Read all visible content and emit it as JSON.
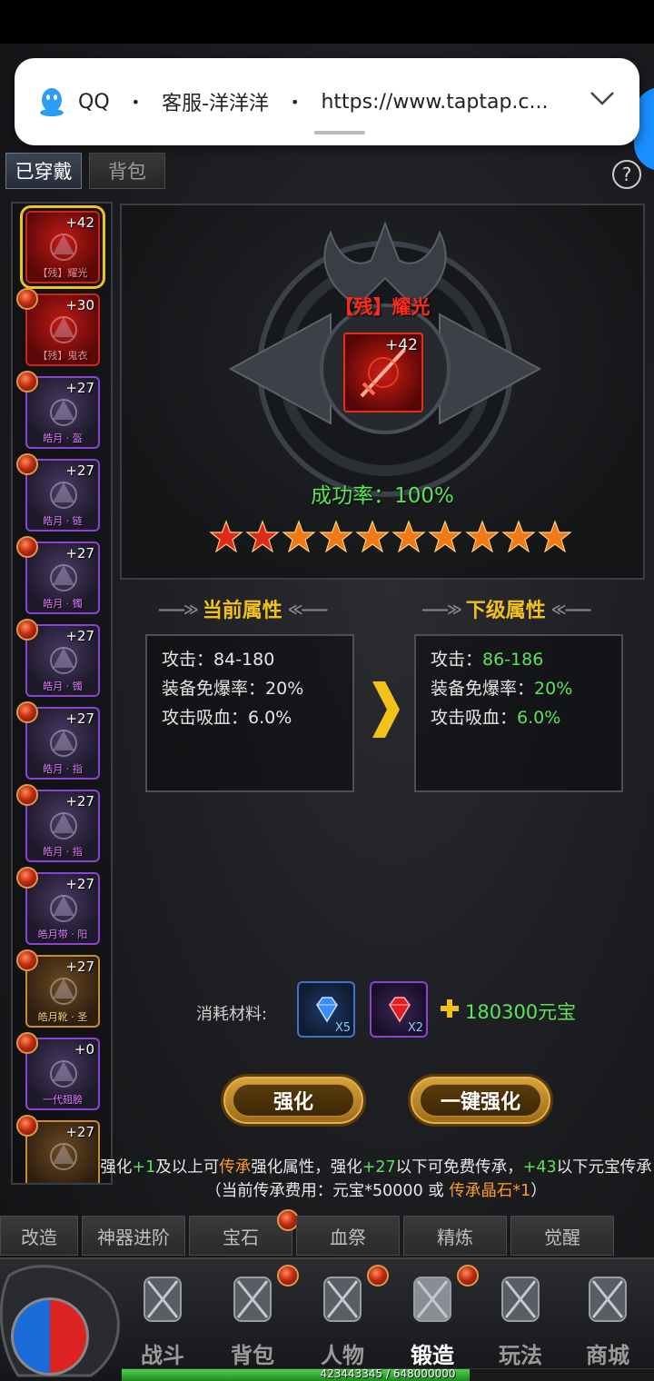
{
  "notification": {
    "app": "QQ",
    "contact": "客服-洋洋洋",
    "url": "https://www.taptap.c..."
  },
  "tabs": {
    "worn": "已穿戴",
    "bag": "背包"
  },
  "help": "?",
  "equipment": [
    {
      "level": "+42",
      "name": "【残】耀光",
      "rarity": "red"
    },
    {
      "level": "+30",
      "name": "【残】鬼衣",
      "rarity": "red"
    },
    {
      "level": "+27",
      "name": "皓月 · 盔",
      "rarity": "purple"
    },
    {
      "level": "+27",
      "name": "皓月 · 链",
      "rarity": "purple"
    },
    {
      "level": "+27",
      "name": "皓月 · 镯",
      "rarity": "purple"
    },
    {
      "level": "+27",
      "name": "皓月 · 镯",
      "rarity": "purple"
    },
    {
      "level": "+27",
      "name": "皓月 · 指",
      "rarity": "purple"
    },
    {
      "level": "+27",
      "name": "皓月 · 指",
      "rarity": "purple"
    },
    {
      "level": "+27",
      "name": "皓月带 · 阳",
      "rarity": "purple"
    },
    {
      "level": "+27",
      "name": "皓月靴 · 圣",
      "rarity": "gold"
    },
    {
      "level": "+0",
      "name": "一代翅膀",
      "rarity": "purple"
    },
    {
      "level": "+27",
      "name": "",
      "rarity": "gold"
    }
  ],
  "preview": {
    "item_name": "【残】耀光",
    "item_level": "+42",
    "success_label": "成功率：",
    "success_value": "100%",
    "stars": 10
  },
  "current": {
    "header": "当前属性",
    "rows": [
      {
        "label": "攻击：",
        "value": "84-180"
      },
      {
        "label": "装备免爆率：",
        "value": "20%"
      },
      {
        "label": "攻击吸血：",
        "value": "6.0%"
      }
    ]
  },
  "next": {
    "header": "下级属性",
    "rows": [
      {
        "label": "攻击：",
        "value": "86-186"
      },
      {
        "label": "装备免爆率：",
        "value": "20%"
      },
      {
        "label": "攻击吸血：",
        "value": "6.0%"
      }
    ]
  },
  "materials": {
    "label": "消耗材料:",
    "items": [
      {
        "qty": "X5",
        "gem": "blue-diamond"
      },
      {
        "qty": "X2",
        "gem": "red-gem"
      }
    ],
    "cost": "180300元宝"
  },
  "buttons": {
    "enhance": "强化",
    "one_click": "一键强化"
  },
  "note": {
    "p1": "强化",
    "g1": "+1",
    "p2": "及以上可",
    "o1": "传承",
    "p3": "强化属性，强化",
    "g2": "+27",
    "p4": "以下可免费传承，",
    "g3": "+43",
    "p5": "以下元宝传承（当前传承费用：元宝*50000 或 ",
    "o2": "传承晶石*1",
    "p6": "）"
  },
  "subtabs": [
    "改造",
    "神器进阶",
    "宝石",
    "血祭",
    "精炼",
    "觉醒"
  ],
  "nav": [
    {
      "label": "战斗",
      "badge": false
    },
    {
      "label": "背包",
      "badge": true
    },
    {
      "label": "人物",
      "badge": true
    },
    {
      "label": "锻造",
      "badge": true,
      "active": true
    },
    {
      "label": "玩法",
      "badge": false
    },
    {
      "label": "商城",
      "badge": false
    }
  ],
  "exp": {
    "text": "423443345 / 648000000",
    "fraction": 0.6535
  },
  "colors": {
    "accent_gold": "#f2c21b",
    "green": "#5be35b",
    "red": "#ff2a1a",
    "orange": "#ff9a2a"
  }
}
